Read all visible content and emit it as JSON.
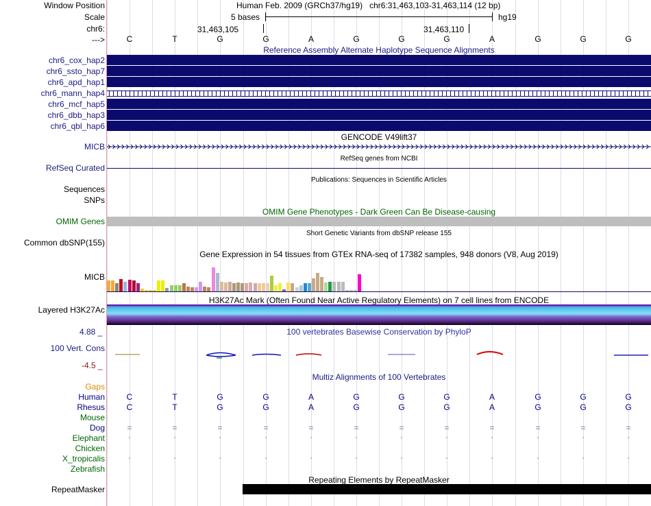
{
  "header": {
    "window_position_label": "Window Position",
    "scale_label": "Scale",
    "chrom_label": "chr6:",
    "arrow_label": "--->",
    "window_title": "Human Feb. 2009 (GRCh37/hg19)   chr6:31,463,103-31,463,114 (12 bp)",
    "scale_text": "5 bases",
    "assembly": "hg19",
    "pos1": "31,463,105",
    "pos2": "31,463,110"
  },
  "sequence": [
    "C",
    "T",
    "G",
    "G",
    "A",
    "G",
    "G",
    "G",
    "A",
    "G",
    "G",
    "G"
  ],
  "alt_haplotypes": {
    "title": "Reference Assembly Alternate Haplotype Sequence Alignments",
    "rows": [
      "chr6_cox_hap2",
      "chr6_ssto_hap7",
      "chr6_apd_hap1",
      "chr6_mann_hap4",
      "chr6_mcf_hap5",
      "chr6_dbb_hap3",
      "chr6_qbl_hap6"
    ]
  },
  "gencode": {
    "title": "GENCODE V49lift37",
    "label": "MICB"
  },
  "refseq": {
    "title": "RefSeq genes from NCBI",
    "label": "RefSeq Curated"
  },
  "publications": {
    "title": "Publications: Sequences in Scientific Articles",
    "label1": "Sequences",
    "label2": "SNPs"
  },
  "omim": {
    "title": "OMIM Gene Phenotypes - Dark Green Can Be Disease-causing",
    "label": "OMIM Genes"
  },
  "dbsnp": {
    "title": "Short Genetic Variants from dbSNP release 155",
    "label": "Common dbSNP(155)"
  },
  "gtex": {
    "title": "Gene Expression in 54 tissues from GTEx RNA-seq of 17382 samples, 948 donors (V8, Aug 2019)",
    "label": "MICB",
    "levels": [
      0.35,
      0.35,
      0.25,
      0.4,
      0.3,
      0.38,
      0.35,
      0.25,
      0.08,
      0.05,
      0.05,
      0.05,
      0.35,
      0.35,
      0.1,
      0.2,
      0.2,
      0.2,
      0.25,
      0.15,
      0.12,
      0.12,
      0.3,
      0.15,
      0.12,
      0.75,
      0.58,
      0.3,
      0.28,
      0.3,
      0.25,
      0.28,
      0.25,
      0.25,
      0.28,
      0.25,
      0.25,
      0.25,
      0.25,
      0.5,
      0.2,
      0.25,
      0.07,
      0.28,
      0.25,
      0.12,
      0.2,
      0.25,
      0.25,
      0.42,
      0.58,
      0.45,
      0.28,
      0.3,
      0.3,
      0.3,
      0.3,
      0.05,
      0.05,
      0.05,
      0.55
    ],
    "colors": [
      "#f4a940",
      "#f4a940",
      "#888877",
      "#c01020",
      "#99b4de",
      "#c01060",
      "#b01030",
      "#a02080",
      "#eecc22",
      "#eecc22",
      "#eecc22",
      "#eecc22",
      "#eeee00",
      "#eeee00",
      "#999999",
      "#99cc66",
      "#99cc66",
      "#99cc66",
      "#bb7744",
      "#bb8855",
      "#bb8855",
      "#cc99ee",
      "#cc99ee",
      "#bb8855",
      "#bb8855",
      "#ee88dd",
      "#aabbcc",
      "#ddbb99",
      "#ddbb99",
      "#ccaa99",
      "#aa9977",
      "#aa9977",
      "#aa9977",
      "#ddaaaa",
      "#ddaaaa",
      "#ccaaaa",
      "#eecc99",
      "#eecc99",
      "#eeccbb",
      "#aacc44",
      "#eeee44",
      "#eeee44",
      "#7766cc",
      "#ffdd66",
      "#c8a888",
      "#ddcccc",
      "#aacccc",
      "#2288cc",
      "#55aacc",
      "#c8aa88",
      "#c8aa88",
      "#c8aa88",
      "#aadd99",
      "#229944",
      "#bbbbbb",
      "#bbbbbb",
      "#bbbbbb",
      "#bbbbbb",
      "#bbbbbb",
      "#bbbbbb",
      "#ff00cc"
    ]
  },
  "h3k27ac": {
    "title": "H3K27Ac Mark (Often Found Near Active Regulatory Elements) on 7 cell lines from ENCODE",
    "label": "Layered H3K27Ac"
  },
  "phylop": {
    "title": "100 vertebrates Basewise Conservation by PhyloP",
    "label": "100 Vert. Cons",
    "max": "4.88 _",
    "min": "-4.5 _"
  },
  "multiz": {
    "title": "Multiz Alignments of 100 Vertebrates",
    "gaps_label": "Gaps",
    "species": [
      {
        "name": "Human",
        "color": "#000080",
        "bases": [
          "C",
          "T",
          "G",
          "G",
          "A",
          "G",
          "G",
          "G",
          "A",
          "G",
          "G",
          "G"
        ]
      },
      {
        "name": "Rhesus",
        "color": "#000080",
        "bases": [
          "C",
          "T",
          "G",
          "G",
          "A",
          "G",
          "G",
          "G",
          "A",
          "G",
          "G",
          "G"
        ]
      },
      {
        "name": "Mouse",
        "color": "#006400",
        "bases": [
          "",
          "",
          "",
          "",
          "",
          "",
          "",
          "",
          "",
          "",
          "",
          ""
        ]
      },
      {
        "name": "Dog",
        "color": "#000080",
        "bases": [
          "=",
          "=",
          "=",
          "=",
          "=",
          "=",
          "=",
          "=",
          "=",
          "=",
          "=",
          "="
        ]
      },
      {
        "name": "Elephant",
        "color": "#006400",
        "bases": [
          "-",
          "-",
          "-",
          "-",
          "-",
          "-",
          "-",
          "-",
          "-",
          "-",
          "-",
          "-"
        ]
      },
      {
        "name": "Chicken",
        "color": "#006400",
        "bases": [
          "",
          "",
          "",
          "",
          "",
          "",
          "",
          "",
          "",
          "",
          "",
          ""
        ]
      },
      {
        "name": "X_tropicalis",
        "color": "#006400",
        "bases": [
          "-",
          "-",
          "-",
          "-",
          "-",
          "-",
          "-",
          "-",
          "-",
          "-",
          "-",
          "-"
        ]
      },
      {
        "name": "Zebrafish",
        "color": "#006400",
        "bases": [
          "",
          "",
          "",
          "",
          "",
          "",
          "",
          "",
          "",
          "",
          "",
          ""
        ]
      }
    ]
  },
  "repeatmasker": {
    "title": "Repeating Elements by RepeatMasker",
    "label": "RepeatMasker"
  },
  "colors": {
    "navy": "#0b0b6e",
    "label_blue": "#1a1a80",
    "omim_green": "#006400",
    "gaps_orange": "#e08a00"
  }
}
